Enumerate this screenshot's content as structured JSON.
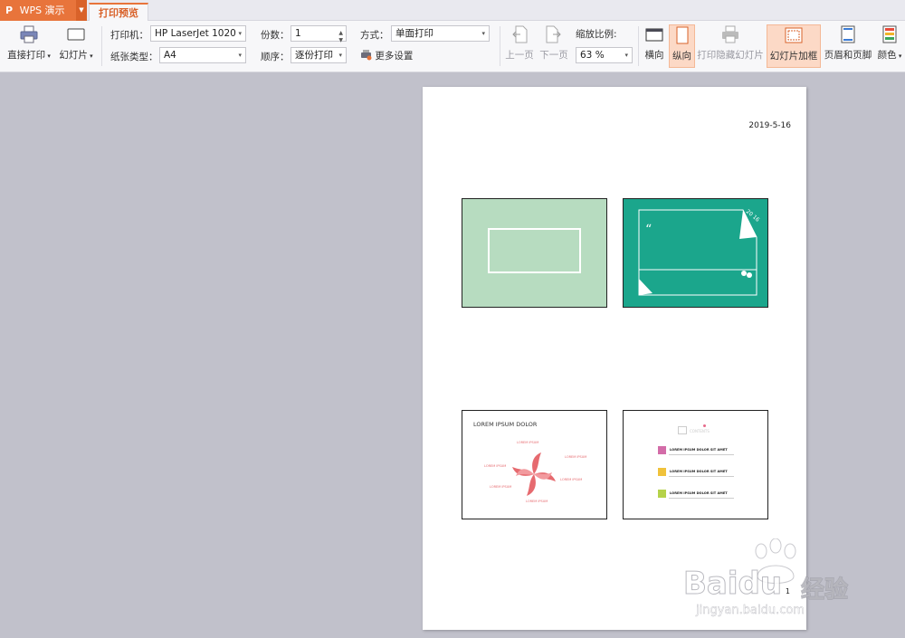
{
  "app": {
    "name": "WPS 演示",
    "active_tab": "打印预览"
  },
  "toolbar": {
    "direct_print": "直接打印",
    "slides": "幻灯片",
    "printer_label": "打印机：",
    "printer_value": "HP LaserJet 1020",
    "paper_label": "纸张类型：",
    "paper_value": "A4",
    "copies_label": "份数：",
    "copies_value": "1",
    "order_label": "顺序：",
    "order_value": "逐份打印",
    "mode_label": "方式：",
    "mode_value": "单面打印",
    "more_settings": "更多设置",
    "prev_page": "上一页",
    "next_page": "下一页",
    "zoom_label": "缩放比例:",
    "zoom_value": "63 %",
    "landscape": "横向",
    "portrait": "纵向",
    "print_hidden": "打印隐藏幻灯片",
    "slide_frame": "幻灯片加框",
    "header_footer": "页眉和页脚",
    "color": "颜色"
  },
  "preview": {
    "date": "2019-5-16",
    "page_number": "1",
    "slide3_title": "LOREM IPSUM DOLOR",
    "slide3_labels": [
      "LOREM IPSUM",
      "LOREM IPSUM",
      "LOREM IPSUM",
      "LOREM IPSUM",
      "LOREM IPSUM",
      "LOREM IPSUM"
    ],
    "slide4_heading": "CONTENTS",
    "slide4_items": [
      "LOREM IPSUM DOLOR SIT AMET",
      "LOREM IPSUM DOLOR SIT AMET",
      "LOREM IPSUM DOLOR SIT AMET"
    ],
    "slide2_number": "20 16"
  },
  "watermark": {
    "brand": "Bai",
    "brand2": "du",
    "cn": "经验",
    "url": "jingyan.baidu.com"
  },
  "colors": {
    "accent": "#e8743b",
    "slide1_bg": "#b7dcc0",
    "slide2_bg": "#1ba68c",
    "canvas": "#c1c1cb"
  }
}
